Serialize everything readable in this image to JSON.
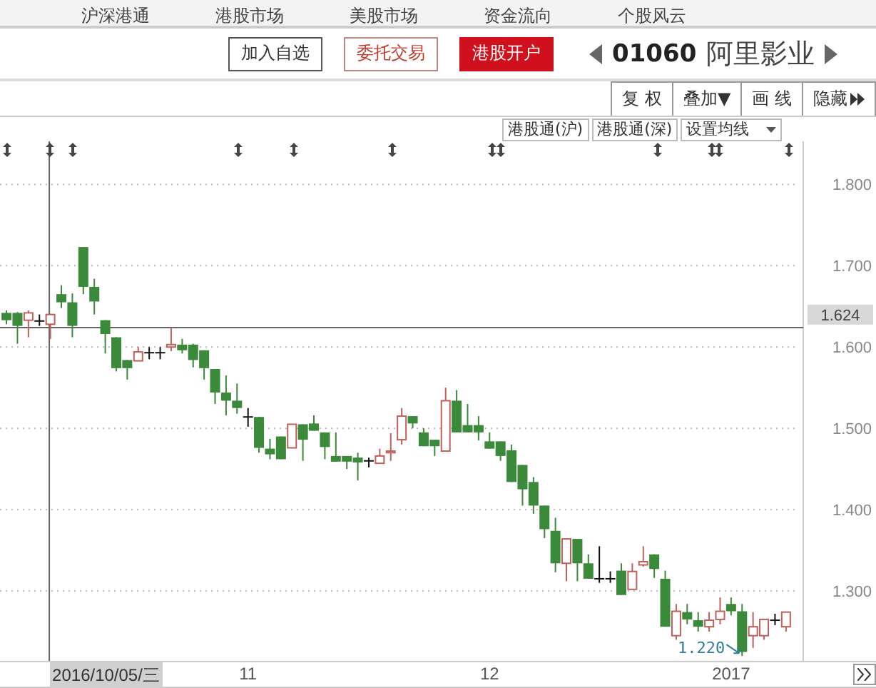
{
  "nav": [
    "沪深港通",
    "港股市场",
    "美股市场",
    "资金流向",
    "个股风云"
  ],
  "actions": [
    {
      "label": "加入自选",
      "kind": "plain"
    },
    {
      "label": "委托交易",
      "kind": "outline"
    },
    {
      "label": "港股开户",
      "kind": "primary"
    }
  ],
  "stock": {
    "code": "01060",
    "name": "阿里影业"
  },
  "toolbar": [
    {
      "label": "复 权",
      "kind": "plain"
    },
    {
      "label": "叠加▼",
      "kind": "plain"
    },
    {
      "label": "画 线",
      "kind": "plain"
    },
    {
      "label": "隐藏",
      "kind": "more"
    }
  ],
  "filters": [
    {
      "label": "港股通(沪)",
      "kind": "plain"
    },
    {
      "label": "港股通(深)",
      "kind": "plain"
    },
    {
      "label": "设置均线",
      "kind": "dropdown"
    }
  ],
  "chart": {
    "chart_data": {
      "type": "candlestick",
      "grid": true,
      "ylim": [
        1.214,
        1.853
      ],
      "categories": [
        null,
        null,
        null,
        null,
        null,
        null,
        null,
        null,
        null,
        null,
        null,
        null,
        null,
        null,
        null,
        null,
        null,
        null,
        null,
        null,
        null,
        null,
        "11",
        null,
        null,
        null,
        null,
        null,
        null,
        null,
        null,
        null,
        null,
        null,
        null,
        null,
        null,
        null,
        null,
        null,
        null,
        null,
        null,
        null,
        "12",
        null,
        null,
        null,
        null,
        null,
        null,
        null,
        null,
        null,
        null,
        null,
        null,
        null,
        null,
        null,
        null,
        null,
        null,
        null,
        null,
        null,
        "2017",
        null,
        null,
        null,
        null,
        null
      ],
      "yticks": [
        {
          "value": 1.8,
          "label": "1.800"
        },
        {
          "value": 1.7,
          "label": "1.700"
        },
        {
          "value": 1.6,
          "label": "1.600"
        },
        {
          "value": 1.5,
          "label": "1.500"
        },
        {
          "value": 1.4,
          "label": "1.400"
        },
        {
          "value": 1.3,
          "label": "1.300"
        }
      ],
      "ohlc": [
        [
          1.642,
          1.645,
          1.628,
          1.633
        ],
        [
          1.642,
          1.643,
          1.604,
          1.626
        ],
        [
          1.633,
          1.645,
          1.612,
          1.642
        ],
        [
          1.632,
          1.64,
          1.626,
          1.632
        ],
        [
          1.628,
          1.641,
          1.61,
          1.64
        ],
        [
          1.665,
          1.676,
          1.648,
          1.655
        ],
        [
          1.655,
          1.666,
          1.612,
          1.626
        ],
        [
          1.723,
          1.723,
          1.665,
          1.674
        ],
        [
          1.674,
          1.684,
          1.64,
          1.656
        ],
        [
          1.633,
          1.633,
          1.592,
          1.616
        ],
        [
          1.612,
          1.612,
          1.57,
          1.574
        ],
        [
          1.584,
          1.584,
          1.56,
          1.574
        ],
        [
          1.583,
          1.6,
          1.583,
          1.594
        ],
        [
          1.593,
          1.6,
          1.585,
          1.593
        ],
        [
          1.593,
          1.6,
          1.585,
          1.593
        ],
        [
          1.6,
          1.623,
          1.595,
          1.603
        ],
        [
          1.603,
          1.61,
          1.592,
          1.596
        ],
        [
          1.603,
          1.604,
          1.575,
          1.584
        ],
        [
          1.596,
          1.596,
          1.56,
          1.574
        ],
        [
          1.573,
          1.573,
          1.53,
          1.544
        ],
        [
          1.544,
          1.565,
          1.516,
          1.534
        ],
        [
          1.534,
          1.555,
          1.518,
          1.525
        ],
        [
          1.514,
          1.525,
          1.502,
          1.514
        ],
        [
          1.514,
          1.514,
          1.47,
          1.476
        ],
        [
          1.475,
          1.487,
          1.462,
          1.468
        ],
        [
          1.49,
          1.49,
          1.462,
          1.462
        ],
        [
          1.476,
          1.505,
          1.476,
          1.505
        ],
        [
          1.505,
          1.505,
          1.46,
          1.486
        ],
        [
          1.506,
          1.516,
          1.497,
          1.497
        ],
        [
          1.495,
          1.495,
          1.462,
          1.477
        ],
        [
          1.466,
          1.495,
          1.459,
          1.459
        ],
        [
          1.466,
          1.466,
          1.45,
          1.459
        ],
        [
          1.464,
          1.47,
          1.436,
          1.458
        ],
        [
          1.46,
          1.464,
          1.452,
          1.46
        ],
        [
          1.457,
          1.475,
          1.457,
          1.466
        ],
        [
          1.47,
          1.494,
          1.46,
          1.472
        ],
        [
          1.486,
          1.525,
          1.48,
          1.515
        ],
        [
          1.515,
          1.515,
          1.5,
          1.506
        ],
        [
          1.495,
          1.5,
          1.478,
          1.478
        ],
        [
          1.486,
          1.486,
          1.466,
          1.478
        ],
        [
          1.472,
          1.55,
          1.472,
          1.534
        ],
        [
          1.534,
          1.547,
          1.495,
          1.495
        ],
        [
          1.504,
          1.53,
          1.495,
          1.495
        ],
        [
          1.504,
          1.515,
          1.485,
          1.495
        ],
        [
          1.484,
          1.495,
          1.475,
          1.475
        ],
        [
          1.484,
          1.484,
          1.46,
          1.466
        ],
        [
          1.473,
          1.48,
          1.434,
          1.434
        ],
        [
          1.455,
          1.455,
          1.405,
          1.425
        ],
        [
          1.434,
          1.44,
          1.395,
          1.405
        ],
        [
          1.405,
          1.405,
          1.365,
          1.376
        ],
        [
          1.374,
          1.39,
          1.323,
          1.334
        ],
        [
          1.334,
          1.364,
          1.312,
          1.364
        ],
        [
          1.364,
          1.364,
          1.312,
          1.334
        ],
        [
          1.334,
          1.345,
          1.315,
          1.315
        ],
        [
          1.315,
          1.355,
          1.31,
          1.315
        ],
        [
          1.315,
          1.324,
          1.31,
          1.315
        ],
        [
          1.325,
          1.334,
          1.295,
          1.295
        ],
        [
          1.302,
          1.334,
          1.302,
          1.324
        ],
        [
          1.332,
          1.355,
          1.33,
          1.336
        ],
        [
          1.345,
          1.345,
          1.316,
          1.327
        ],
        [
          1.315,
          1.325,
          1.256,
          1.256
        ],
        [
          1.245,
          1.284,
          1.24,
          1.275
        ],
        [
          1.274,
          1.284,
          1.259,
          1.265
        ],
        [
          1.264,
          1.274,
          1.25,
          1.256
        ],
        [
          1.256,
          1.274,
          1.25,
          1.264
        ],
        [
          1.265,
          1.292,
          1.259,
          1.275
        ],
        [
          1.284,
          1.292,
          1.27,
          1.275
        ],
        [
          1.275,
          1.284,
          1.22,
          1.225
        ],
        [
          1.245,
          1.274,
          1.23,
          1.256
        ],
        [
          1.245,
          1.265,
          1.24,
          1.265
        ],
        [
          1.264,
          1.272,
          1.258,
          1.264
        ],
        [
          1.256,
          1.274,
          1.25,
          1.274
        ]
      ],
      "ref_lines": [
        {
          "axis": "y",
          "value": 1.624,
          "label": "1.624"
        }
      ],
      "annotations": [
        "1.220"
      ]
    },
    "crosshair_date": "2016/10/05/三"
  }
}
